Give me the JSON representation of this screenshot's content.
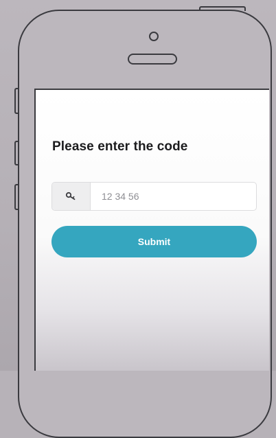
{
  "screen": {
    "title": "Please enter the code",
    "code_field": {
      "placeholder": "12 34 56",
      "value": "",
      "icon": "key-icon"
    },
    "submit_label": "Submit"
  },
  "colors": {
    "accent": "#35a6bf",
    "background": "#b7b2b8",
    "outline": "#3a3a3f"
  }
}
